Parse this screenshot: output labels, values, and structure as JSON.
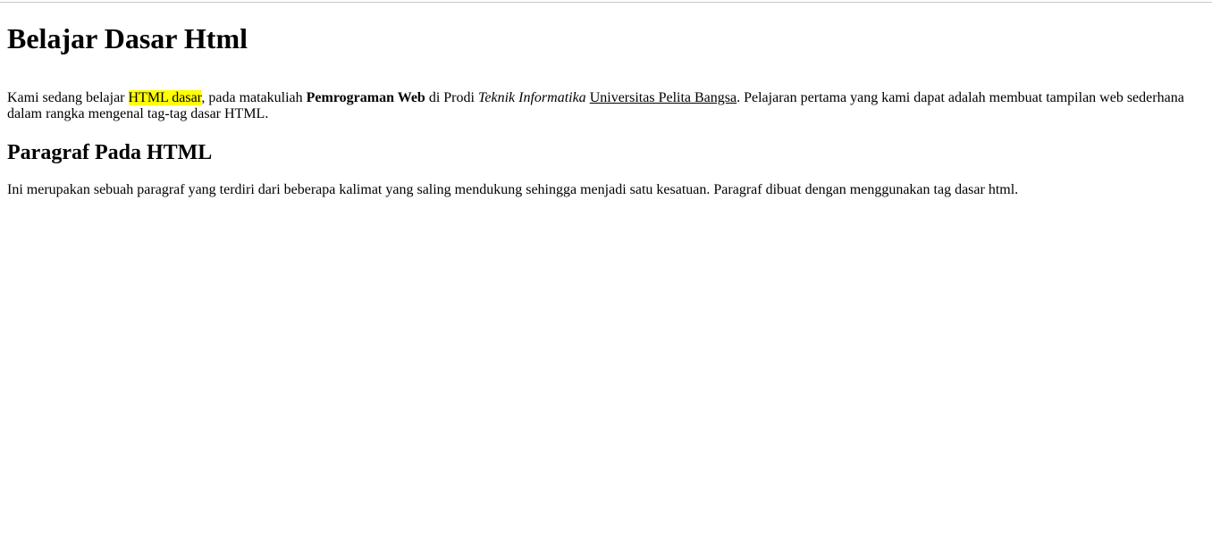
{
  "heading": "Belajar Dasar Html",
  "intro": {
    "t1": "Kami sedang belajar ",
    "highlight": "HTML dasar",
    "t2": ", pada matakuliah ",
    "bold": "Pemrograman Web",
    "t3": " di Prodi ",
    "italic": "Teknik Informatika",
    "t4": " ",
    "underline": "Universitas Pelita Bangsa",
    "t5": ". Pelajaran pertama yang kami dapat adalah membuat tampilan web sederhana dalam rangka mengenal tag-tag dasar HTML."
  },
  "subheading": "Paragraf Pada HTML",
  "paragraph2": "Ini merupakan sebuah paragraf yang terdiri dari beberapa kalimat yang saling mendukung sehingga menjadi satu kesatuan. Paragraf dibuat dengan menggunakan tag dasar html.",
  "colors": {
    "highlight": "#ffff00",
    "text": "#000000",
    "background": "#ffffff"
  }
}
